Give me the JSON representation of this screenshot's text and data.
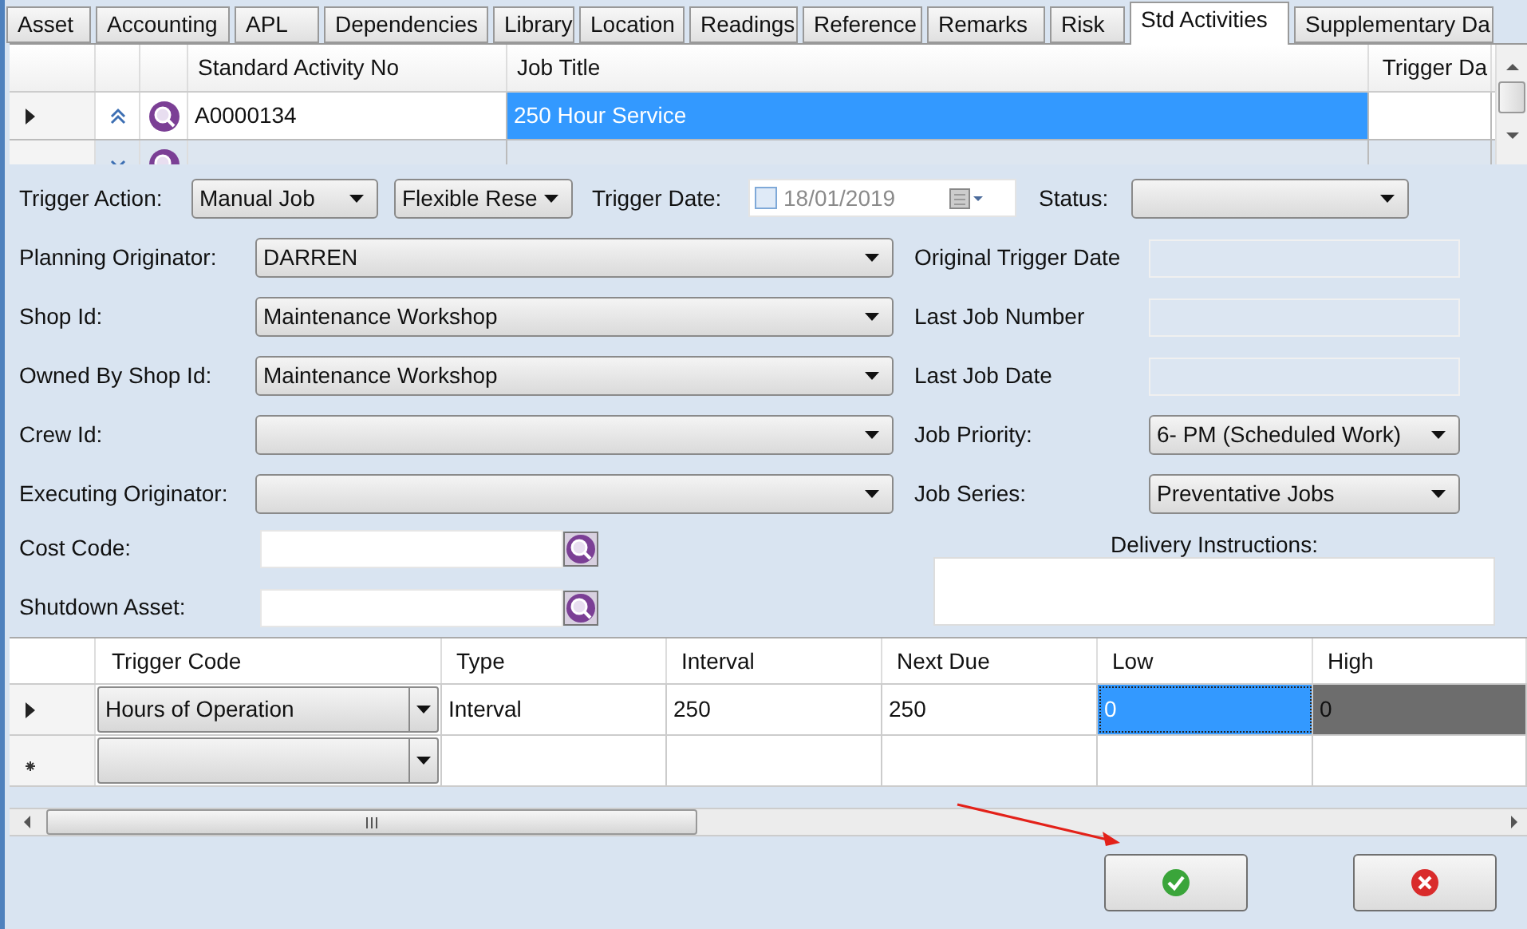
{
  "tabs": [
    {
      "label": "Asset",
      "selected": false
    },
    {
      "label": "Accounting",
      "selected": false
    },
    {
      "label": "APL",
      "selected": false
    },
    {
      "label": "Dependencies",
      "selected": false
    },
    {
      "label": "Library",
      "selected": false
    },
    {
      "label": "Location",
      "selected": false
    },
    {
      "label": "Readings",
      "selected": false
    },
    {
      "label": "Reference",
      "selected": false
    },
    {
      "label": "Remarks",
      "selected": false
    },
    {
      "label": "Risk",
      "selected": false
    },
    {
      "label": "Std Activities",
      "selected": true
    },
    {
      "label": "Supplementary Da",
      "selected": false
    }
  ],
  "activities_grid": {
    "columns": [
      "Standard Activity No",
      "Job Title",
      "Trigger Da"
    ],
    "rows": [
      {
        "current": true,
        "expanded": true,
        "cells": [
          {
            "text": "A0000134",
            "selected": false
          },
          {
            "text": "250 Hour Service",
            "selected": true
          },
          {
            "selected": false
          }
        ]
      },
      {
        "current": false,
        "expanded": false,
        "cells": [
          {
            "selected": false
          },
          {
            "selected": false
          },
          {
            "selected": false
          }
        ]
      }
    ]
  },
  "trigger_action": {
    "label": "Trigger Action:",
    "values": [
      "Manual Job",
      "Flexible Rese"
    ]
  },
  "trigger_date": {
    "label": "Trigger Date:",
    "checked": false,
    "value": "18/01/2019"
  },
  "status": {
    "label": "Status:"
  },
  "left_fields": [
    {
      "label": "Planning Originator:",
      "value": "DARREN"
    },
    {
      "label": "Shop Id:",
      "value": "Maintenance Workshop"
    },
    {
      "label": "Owned By Shop Id:",
      "value": "Maintenance Workshop"
    },
    {
      "label": "Crew Id:"
    },
    {
      "label": "Executing Originator:"
    }
  ],
  "right_fields": [
    {
      "label": "Original Trigger Date",
      "kind": "readonly"
    },
    {
      "label": "Last Job Number",
      "kind": "readonly"
    },
    {
      "label": "Last Job Date",
      "kind": "readonly"
    },
    {
      "label": "Job Priority:",
      "kind": "dropdown",
      "value": "6- PM (Scheduled Work)"
    },
    {
      "label": "Job Series:",
      "kind": "dropdown",
      "value": "Preventative Jobs"
    }
  ],
  "lookup_fields": [
    {
      "label": "Cost Code:"
    },
    {
      "label": "Shutdown Asset:"
    }
  ],
  "delivery_instructions": {
    "label": "Delivery Instructions:"
  },
  "triggers_grid": {
    "columns": [
      "Trigger Code",
      "Type",
      "Interval",
      "Next Due",
      "Low",
      "High"
    ],
    "rows": [
      {
        "kind": "current",
        "cells": [
          {
            "text": "Hours of Operation",
            "selected": false,
            "focused": false
          },
          {
            "text": "Interval",
            "selected": false,
            "focused": false
          },
          {
            "text": "250",
            "selected": false,
            "focused": false
          },
          {
            "text": "250",
            "selected": false,
            "focused": false
          },
          {
            "text": "0",
            "selected": true,
            "focused": true
          },
          {
            "text": "0",
            "selected": true,
            "focused": false
          }
        ]
      },
      {
        "kind": "new",
        "cells": [
          {
            "selected": false,
            "focused": false
          },
          {
            "selected": false,
            "focused": false
          },
          {
            "selected": false,
            "focused": false
          },
          {
            "selected": false,
            "focused": false
          },
          {
            "selected": false,
            "focused": false
          },
          {
            "selected": false,
            "focused": false
          }
        ]
      }
    ]
  },
  "buttons": [
    {
      "kind": "ok"
    },
    {
      "kind": "cancel"
    }
  ]
}
